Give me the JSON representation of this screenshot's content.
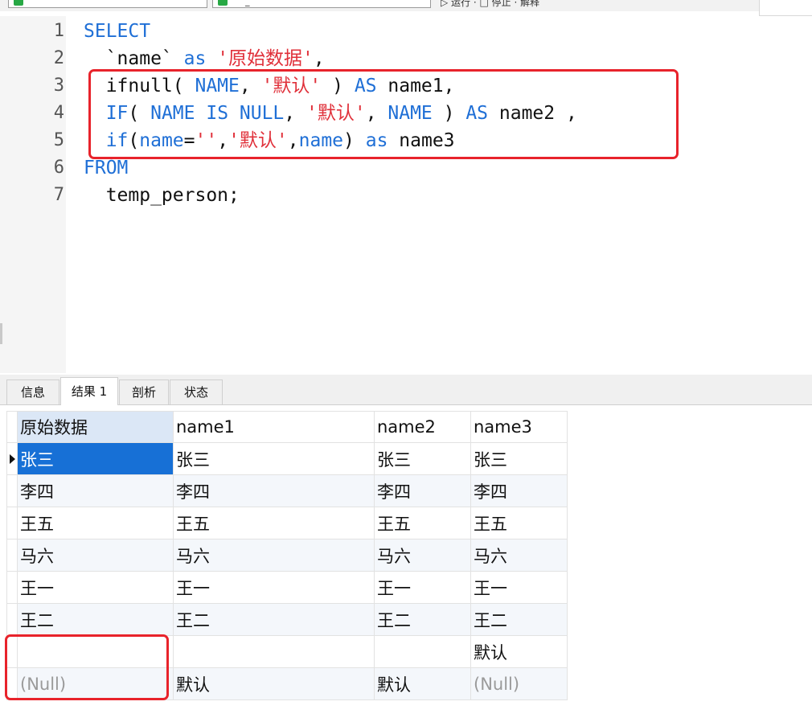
{
  "toolbar": {
    "combo_left_text": "",
    "combo_right_text": "_",
    "actions": "▷ 运行 · □ 停止 · 解释"
  },
  "editor": {
    "lines": [
      {
        "no": "1",
        "tokens": [
          {
            "t": "SELECT",
            "c": "kw"
          }
        ]
      },
      {
        "no": "2",
        "tokens": [
          {
            "t": "  `name` ",
            "c": "plain"
          },
          {
            "t": "as",
            "c": "kw"
          },
          {
            "t": " ",
            "c": "plain"
          },
          {
            "t": "'原始数据'",
            "c": "str"
          },
          {
            "t": ",",
            "c": "plain"
          }
        ]
      },
      {
        "no": "3",
        "tokens": [
          {
            "t": "  ifnull( ",
            "c": "plain"
          },
          {
            "t": "NAME",
            "c": "kw"
          },
          {
            "t": ", ",
            "c": "plain"
          },
          {
            "t": "'默认'",
            "c": "str"
          },
          {
            "t": " ) ",
            "c": "plain"
          },
          {
            "t": "AS",
            "c": "kw"
          },
          {
            "t": " name1,",
            "c": "plain"
          }
        ]
      },
      {
        "no": "4",
        "tokens": [
          {
            "t": "  ",
            "c": "plain"
          },
          {
            "t": "IF",
            "c": "kw"
          },
          {
            "t": "( ",
            "c": "plain"
          },
          {
            "t": "NAME IS NULL",
            "c": "kw"
          },
          {
            "t": ", ",
            "c": "plain"
          },
          {
            "t": "'默认'",
            "c": "str"
          },
          {
            "t": ", ",
            "c": "plain"
          },
          {
            "t": "NAME",
            "c": "kw"
          },
          {
            "t": " ) ",
            "c": "plain"
          },
          {
            "t": "AS",
            "c": "kw"
          },
          {
            "t": " name2 ,",
            "c": "plain"
          }
        ]
      },
      {
        "no": "5",
        "tokens": [
          {
            "t": "  ",
            "c": "plain"
          },
          {
            "t": "if",
            "c": "kw"
          },
          {
            "t": "(",
            "c": "plain"
          },
          {
            "t": "name",
            "c": "kw"
          },
          {
            "t": "=",
            "c": "plain"
          },
          {
            "t": "''",
            "c": "str"
          },
          {
            "t": ",",
            "c": "plain"
          },
          {
            "t": "'默认'",
            "c": "str"
          },
          {
            "t": ",",
            "c": "plain"
          },
          {
            "t": "name",
            "c": "kw"
          },
          {
            "t": ") ",
            "c": "plain"
          },
          {
            "t": "as",
            "c": "kw"
          },
          {
            "t": " name3",
            "c": "plain"
          }
        ]
      },
      {
        "no": "6",
        "tokens": [
          {
            "t": "FROM",
            "c": "kw"
          }
        ]
      },
      {
        "no": "7",
        "tokens": [
          {
            "t": "  temp_person;",
            "c": "plain"
          }
        ]
      }
    ]
  },
  "tabs": [
    {
      "label": "信息",
      "active": false
    },
    {
      "label": "结果 1",
      "active": true
    },
    {
      "label": "剖析",
      "active": false
    },
    {
      "label": "状态",
      "active": false
    }
  ],
  "grid": {
    "columns": [
      "原始数据",
      "name1",
      "name2",
      "name3"
    ],
    "rows": [
      [
        "张三",
        "张三",
        "张三",
        "张三"
      ],
      [
        "李四",
        "李四",
        "李四",
        "李四"
      ],
      [
        "王五",
        "王五",
        "王五",
        "王五"
      ],
      [
        "马六",
        "马六",
        "马六",
        "马六"
      ],
      [
        "王一",
        "王一",
        "王一",
        "王一"
      ],
      [
        "王二",
        "王二",
        "王二",
        "王二"
      ],
      [
        "",
        "",
        "",
        "默认"
      ],
      [
        "(Null)",
        "默认",
        "默认",
        "(Null)"
      ]
    ],
    "null_text": "(Null)",
    "selected_cell": [
      0,
      0
    ]
  },
  "colors": {
    "keyword": "#1f6fd6",
    "string": "#e0303a",
    "highlight_box": "#e8232b",
    "selection": "#1770d6",
    "null_text": "#9a9a9a"
  }
}
